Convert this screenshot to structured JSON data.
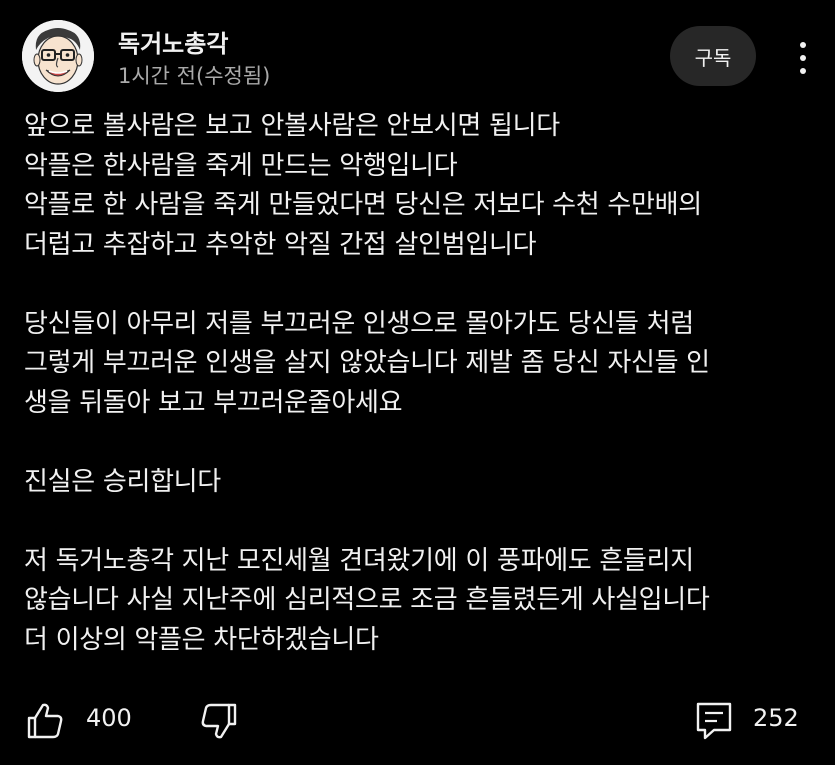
{
  "post": {
    "channel_name": "독거노총각",
    "time": "1시간 전(수정됨)",
    "subscribe_label": "구독",
    "body": {
      "p1": [
        "앞으로 볼사람은 보고 안볼사람은 안보시면 됩니다",
        "악플은 한사람을 죽게 만드는 악행입니다",
        "악플로 한 사람을 죽게 만들었다면 당신은 저보다 수천 수만배의",
        "더럽고 추잡하고 추악한 악질 간접 살인범입니다"
      ],
      "p2": [
        "당신들이 아무리 저를 부끄러운 인생으로 몰아가도 당신들 처럼",
        "그렇게 부끄러운 인생을 살지 않았습니다 제발 좀 당신 자신들 인",
        "생을 뒤돌아 보고 부끄러운줄아세요"
      ],
      "p3": [
        "진실은 승리합니다"
      ],
      "p4": [
        "저 독거노총각 지난 모진세월 견뎌왔기에 이 풍파에도 흔들리지",
        "않습니다 사실 지난주에 심리적으로 조금 흔들렸든게 사실입니다",
        "더 이상의 악플은 차단하겠습니다"
      ]
    },
    "like_count": "400",
    "comment_count": "252"
  },
  "icons": {
    "like": "thumbs-up-icon",
    "dislike": "thumbs-down-icon",
    "comment": "comment-icon",
    "more": "more-vertical-icon"
  },
  "colors": {
    "background": "#000000",
    "text": "#f1f1f1",
    "secondary_text": "#aaaaaa",
    "subscribe_bg": "#272727"
  }
}
